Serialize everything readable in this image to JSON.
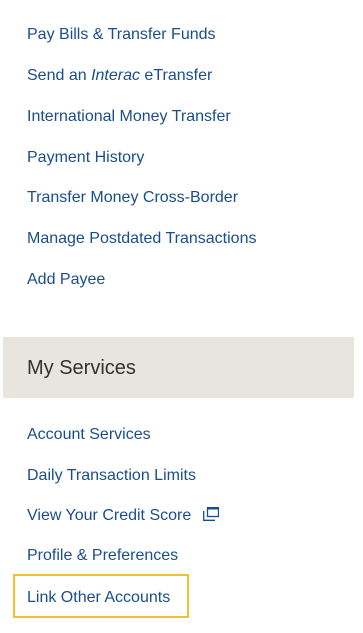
{
  "transfers": {
    "items": [
      {
        "label": "Pay Bills & Transfer Funds"
      },
      {
        "label_prefix": "Send an ",
        "label_em": "Interac",
        "label_suffix": " eTransfer"
      },
      {
        "label": "International Money Transfer"
      },
      {
        "label": "Payment History"
      },
      {
        "label": "Transfer Money Cross-Border"
      },
      {
        "label": "Manage Postdated Transactions"
      },
      {
        "label": "Add Payee"
      }
    ]
  },
  "services": {
    "title": "My Services",
    "items": [
      {
        "label": "Account Services"
      },
      {
        "label": "Daily Transaction Limits"
      },
      {
        "label": "View Your Credit Score",
        "icon": "external-window-icon"
      },
      {
        "label": "Profile & Preferences"
      },
      {
        "label": "Link Other Accounts",
        "highlighted": true
      }
    ]
  },
  "colors": {
    "link": "#1a4d8f",
    "section_bg": "#e8e4de",
    "section_text": "#333333",
    "highlight": "#f0c030"
  }
}
